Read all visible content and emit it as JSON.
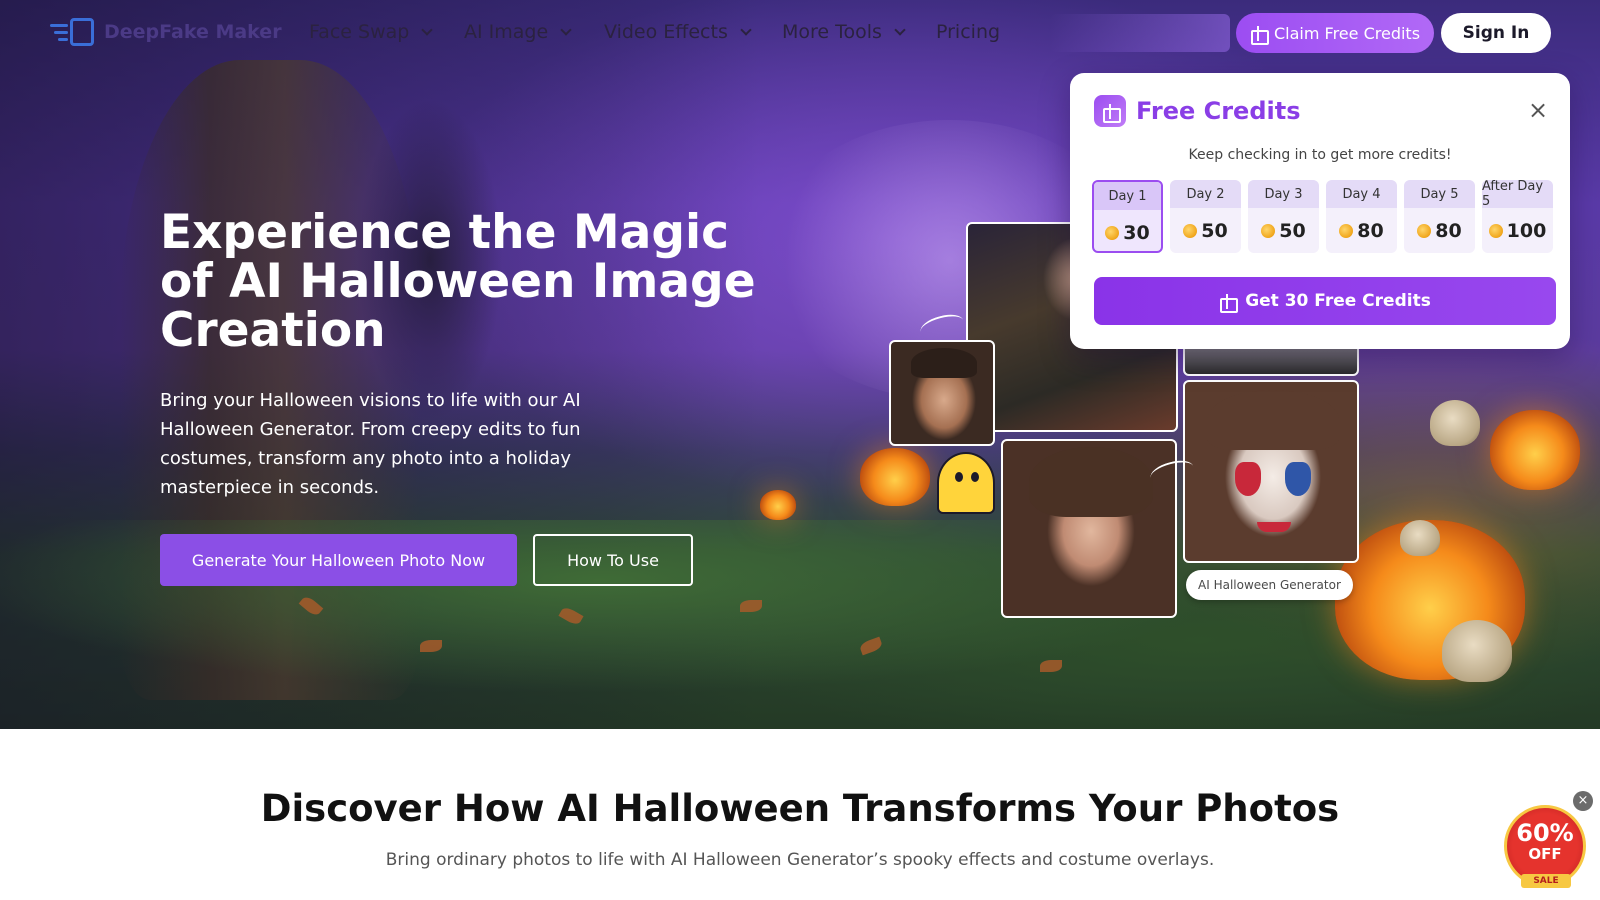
{
  "nav": {
    "logo_text": "DeepFake Maker",
    "items": [
      {
        "label": "Face Swap",
        "has_dropdown": true
      },
      {
        "label": "AI Image",
        "has_dropdown": true
      },
      {
        "label": "Video Effects",
        "has_dropdown": true
      },
      {
        "label": "More Tools",
        "has_dropdown": true
      },
      {
        "label": "Pricing",
        "has_dropdown": false
      }
    ],
    "claim_label": "Claim Free Credits",
    "signin_label": "Sign In"
  },
  "hero": {
    "title": "Experience the Magic of AI Halloween Image Creation",
    "description": "Bring your Halloween visions to life with our AI Halloween Generator. From creepy edits to fun costumes, transform any photo into a holiday masterpiece in seconds.",
    "primary_button": "Generate Your Halloween Photo Now",
    "secondary_button": "How To Use",
    "generator_tag": "AI Halloween Generator"
  },
  "credits_popup": {
    "title": "Free Credits",
    "close_symbol": "×",
    "subtitle": "Keep checking in to get more credits!",
    "days": [
      {
        "label": "Day 1",
        "amount": "30",
        "active": true
      },
      {
        "label": "Day 2",
        "amount": "50",
        "active": false
      },
      {
        "label": "Day 3",
        "amount": "50",
        "active": false
      },
      {
        "label": "Day 4",
        "amount": "80",
        "active": false
      },
      {
        "label": "Day 5",
        "amount": "80",
        "active": false
      },
      {
        "label": "After Day 5",
        "amount": "100",
        "active": false
      }
    ],
    "cta": "Get 30 Free Credits"
  },
  "section": {
    "title": "Discover How AI Halloween Transforms Your Photos",
    "subtitle": "Bring ordinary photos to life with AI Halloween Generator’s spooky effects and costume overlays."
  },
  "sale_badge": {
    "percent": "60%",
    "off": "OFF",
    "tag": "SALE",
    "close_symbol": "×"
  },
  "colors": {
    "accent_purple": "#8a3ee6",
    "hero_purple": "#5a3aa8",
    "sale_red": "#e5332d"
  }
}
